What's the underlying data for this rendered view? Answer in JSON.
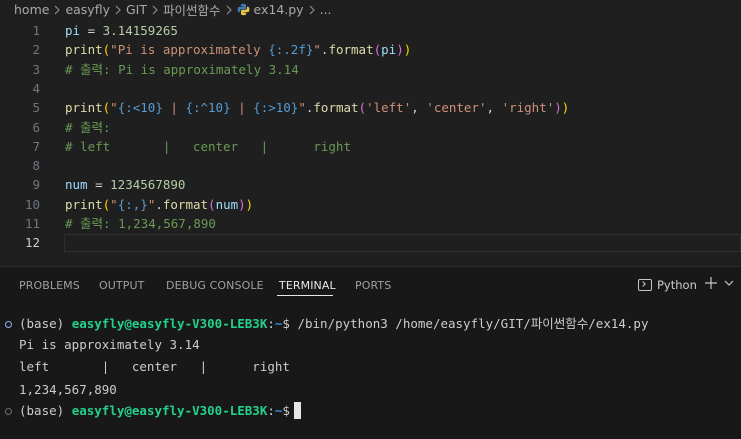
{
  "breadcrumb": {
    "items": [
      "home",
      "easyfly",
      "GIT",
      "파이썬함수",
      "ex14.py",
      "..."
    ]
  },
  "editor": {
    "lines": [
      {
        "n": "1",
        "tokens": [
          [
            "pi",
            "t-var"
          ],
          [
            " = ",
            "t-op"
          ],
          [
            "3.14159265",
            "t-num"
          ]
        ]
      },
      {
        "n": "2",
        "tokens": [
          [
            "print",
            "t-fn"
          ],
          [
            "(",
            "t-p1"
          ],
          [
            "\"Pi is approximately ",
            "t-str"
          ],
          [
            "{:.2f}",
            "t-ph"
          ],
          [
            "\"",
            "t-str"
          ],
          [
            ".",
            "t-op"
          ],
          [
            "format",
            "t-fn"
          ],
          [
            "(",
            "t-p2"
          ],
          [
            "pi",
            "t-var"
          ],
          [
            ")",
            "t-p2"
          ],
          [
            ")",
            "t-p1"
          ]
        ]
      },
      {
        "n": "3",
        "tokens": [
          [
            "# 출력: Pi is approximately 3.14",
            "t-com"
          ]
        ]
      },
      {
        "n": "4",
        "tokens": []
      },
      {
        "n": "5",
        "tokens": [
          [
            "print",
            "t-fn"
          ],
          [
            "(",
            "t-p1"
          ],
          [
            "\"",
            "t-str"
          ],
          [
            "{:<10}",
            "t-ph"
          ],
          [
            " | ",
            "t-str"
          ],
          [
            "{:^10}",
            "t-ph"
          ],
          [
            " | ",
            "t-str"
          ],
          [
            "{:>10}",
            "t-ph"
          ],
          [
            "\"",
            "t-str"
          ],
          [
            ".",
            "t-op"
          ],
          [
            "format",
            "t-fn"
          ],
          [
            "(",
            "t-p2"
          ],
          [
            "'left'",
            "t-str"
          ],
          [
            ", ",
            "t-op"
          ],
          [
            "'center'",
            "t-str"
          ],
          [
            ", ",
            "t-op"
          ],
          [
            "'right'",
            "t-str"
          ],
          [
            ")",
            "t-p2"
          ],
          [
            ")",
            "t-p1"
          ]
        ]
      },
      {
        "n": "6",
        "tokens": [
          [
            "# 출력:",
            "t-com"
          ]
        ]
      },
      {
        "n": "7",
        "tokens": [
          [
            "# left       |   center   |      right",
            "t-com"
          ]
        ]
      },
      {
        "n": "8",
        "tokens": []
      },
      {
        "n": "9",
        "tokens": [
          [
            "num",
            "t-var"
          ],
          [
            " = ",
            "t-op"
          ],
          [
            "1234567890",
            "t-num"
          ]
        ]
      },
      {
        "n": "10",
        "tokens": [
          [
            "print",
            "t-fn"
          ],
          [
            "(",
            "t-p1"
          ],
          [
            "\"",
            "t-str"
          ],
          [
            "{:,}",
            "t-ph"
          ],
          [
            "\"",
            "t-str"
          ],
          [
            ".",
            "t-op"
          ],
          [
            "format",
            "t-fn"
          ],
          [
            "(",
            "t-p2"
          ],
          [
            "num",
            "t-var"
          ],
          [
            ")",
            "t-p2"
          ],
          [
            ")",
            "t-p1"
          ]
        ]
      },
      {
        "n": "11",
        "tokens": [
          [
            "# 출력: 1,234,567,890",
            "t-com"
          ]
        ]
      },
      {
        "n": "12",
        "tokens": []
      }
    ],
    "active_line": "12"
  },
  "panel": {
    "tabs": [
      {
        "label": "PROBLEMS",
        "name": "tab-problems"
      },
      {
        "label": "OUTPUT",
        "name": "tab-output"
      },
      {
        "label": "DEBUG CONSOLE",
        "name": "tab-debug-console"
      },
      {
        "label": "TERMINAL",
        "name": "tab-terminal"
      },
      {
        "label": "PORTS",
        "name": "tab-ports"
      }
    ],
    "active_tab": "TERMINAL",
    "terminal_profile": "Python"
  },
  "terminal": {
    "env": "(base)",
    "user_host": "easyfly@easyfly-V300-LEB3K",
    "cwd": "~",
    "prompt_symbol": "$",
    "command": " /bin/python3 /home/easyfly/GIT/파이썬함수/ex14.py",
    "output": [
      "Pi is approximately 3.14",
      "left       |   center   |      right",
      "1,234,567,890"
    ]
  },
  "colors": {
    "editor_bg": "#1f1f1f",
    "panel_bg": "#181818",
    "prompt_user": "#23d18b",
    "prompt_path": "#3b8eea",
    "comment": "#6a9955",
    "string": "#ce9178"
  }
}
